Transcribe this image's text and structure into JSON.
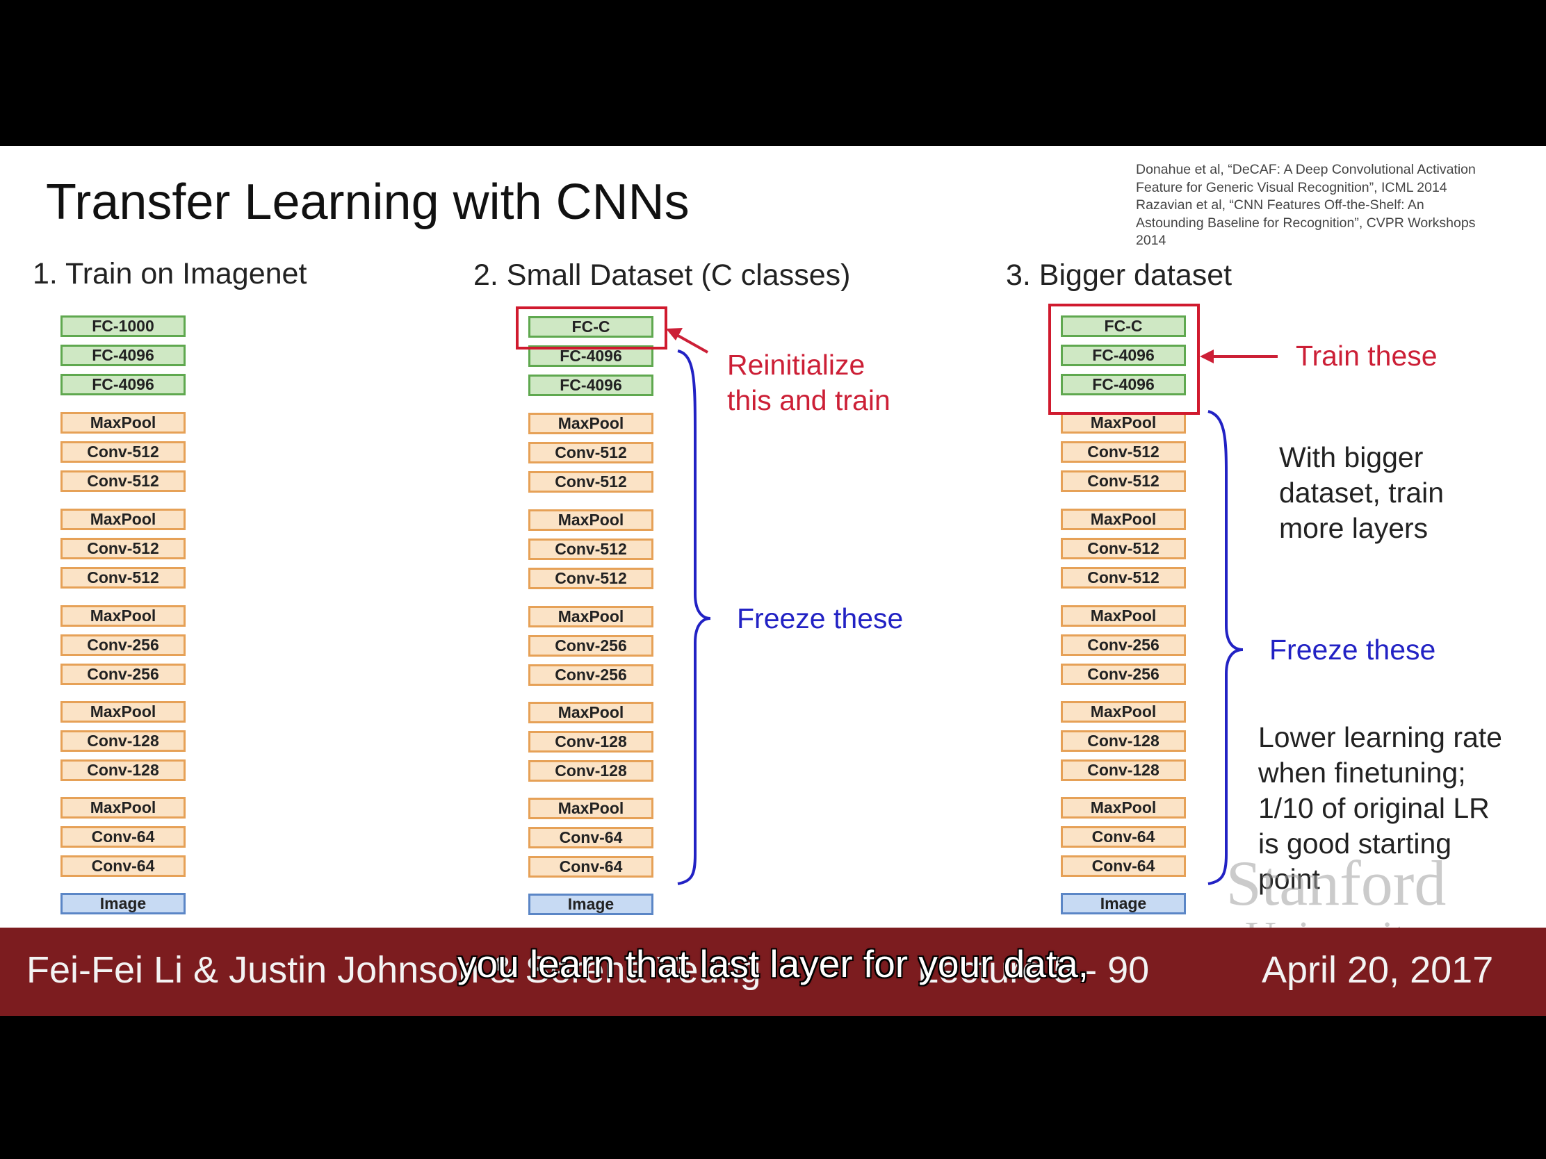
{
  "slide": {
    "title": "Transfer Learning with CNNs",
    "citation": [
      "Donahue et al, “DeCAF: A Deep Convolutional Activation",
      "Feature for Generic Visual Recognition”, ICML 2014",
      "Razavian et al, “CNN Features Off-the-Shelf: An",
      "Astounding Baseline for Recognition”, CVPR Workshops",
      "2014"
    ]
  },
  "columns": [
    {
      "heading": "1. Train on Imagenet",
      "layers": [
        "FC-1000",
        "FC-4096",
        "FC-4096",
        "MaxPool",
        "Conv-512",
        "Conv-512",
        "MaxPool",
        "Conv-512",
        "Conv-512",
        "MaxPool",
        "Conv-256",
        "Conv-256",
        "MaxPool",
        "Conv-128",
        "Conv-128",
        "MaxPool",
        "Conv-64",
        "Conv-64",
        "Image"
      ]
    },
    {
      "heading": "2. Small Dataset (C classes)",
      "layers": [
        "FC-C",
        "FC-4096",
        "FC-4096",
        "MaxPool",
        "Conv-512",
        "Conv-512",
        "MaxPool",
        "Conv-512",
        "Conv-512",
        "MaxPool",
        "Conv-256",
        "Conv-256",
        "MaxPool",
        "Conv-128",
        "Conv-128",
        "MaxPool",
        "Conv-64",
        "Conv-64",
        "Image"
      ],
      "red_annotation": [
        "Reinitialize",
        "this and train"
      ],
      "blue_annotation": "Freeze these"
    },
    {
      "heading": "3. Bigger dataset",
      "layers": [
        "FC-C",
        "FC-4096",
        "FC-4096",
        "MaxPool",
        "Conv-512",
        "Conv-512",
        "MaxPool",
        "Conv-512",
        "Conv-512",
        "MaxPool",
        "Conv-256",
        "Conv-256",
        "MaxPool",
        "Conv-128",
        "Conv-128",
        "MaxPool",
        "Conv-64",
        "Conv-64",
        "Image"
      ],
      "red_annotation": "Train these",
      "note_bigger": [
        "With bigger",
        "dataset, train",
        "more layers"
      ],
      "blue_annotation": "Freeze these",
      "note_lr": [
        "Lower learning rate",
        "when finetuning;",
        "1/10 of original LR",
        "is good starting",
        "point"
      ]
    }
  ],
  "watermark": [
    "Stanford",
    "University"
  ],
  "footer": {
    "left": "Fei-Fei Li & Justin Johnson & Serena Yeung",
    "lecture": "Lecture 5 - 90",
    "date": "April 20, 2017"
  },
  "subtitle": "you learn that last layer for your data,",
  "colors": {
    "fc_border": "#5fa84f",
    "fc_fill": "#cfe8c4",
    "conv_border": "#e6a157",
    "conv_fill": "#fbe3c6",
    "image_border": "#5b86c6",
    "image_fill": "#c7daf3",
    "red": "#cc1f36",
    "blue": "#2222c4",
    "footer_bg": "#7c1c1f"
  }
}
